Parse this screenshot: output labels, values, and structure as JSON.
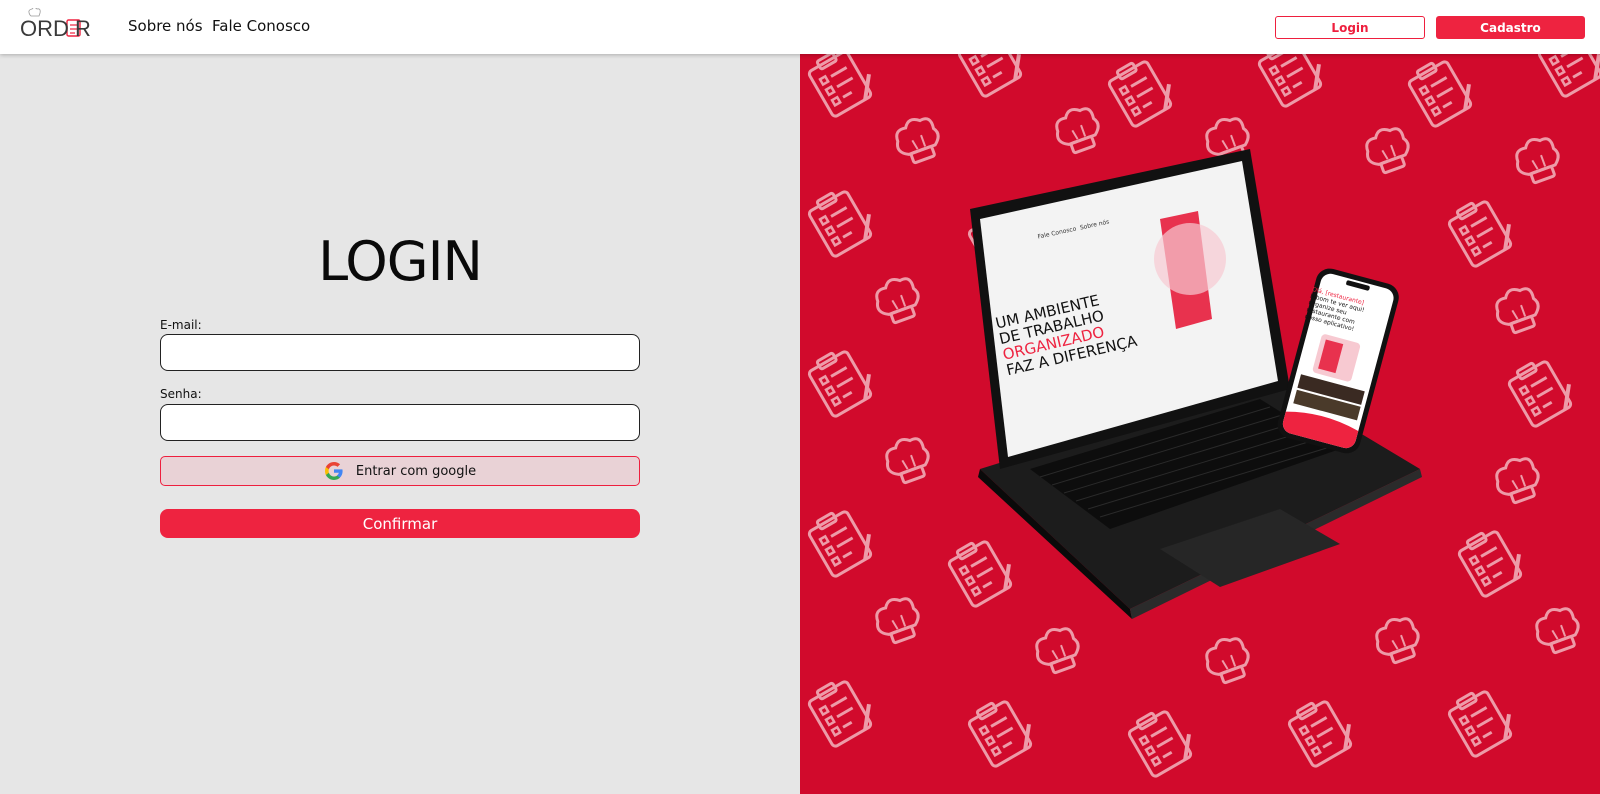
{
  "header": {
    "logo_text": "ORD R",
    "nav": [
      {
        "label": "Sobre nós"
      },
      {
        "label": "Fale Conosco"
      }
    ],
    "login_label": "Login",
    "cadastro_label": "Cadastro"
  },
  "login": {
    "title": "LOGIN",
    "email_label": "E-mail:",
    "email_value": "",
    "password_label": "Senha:",
    "password_value": "",
    "google_label": "Entrar com google",
    "confirm_label": "Confirmar"
  },
  "promo": {
    "laptop_headline_1": "UM AMBIENTE",
    "laptop_headline_2": "DE TRABALHO",
    "laptop_headline_3": "ORGANIZADO",
    "laptop_headline_4": "FAZ A DIFERENÇA",
    "laptop_nav_1": "Fale Conosco",
    "laptop_nav_2": "Sobre nós",
    "phone_text_1": "Olá, [restaurante]",
    "phone_text_2": "É bom te ver aqui!",
    "phone_text_3": "Organize seu restaurante com nosso aplicativo!"
  },
  "colors": {
    "brand_red": "#ee2340",
    "pattern_red": "#d10a2c",
    "panel_gray": "#e6e6e6"
  }
}
